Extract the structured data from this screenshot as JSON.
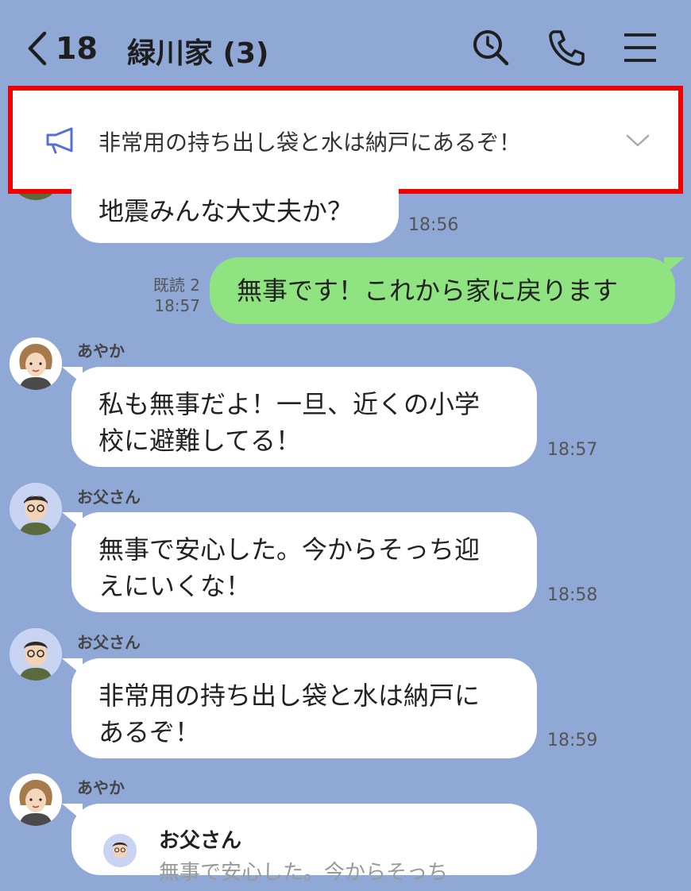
{
  "header": {
    "back_count": "18",
    "title": "緑川家 (3)",
    "icons": [
      "search-icon",
      "phone-icon",
      "menu-icon"
    ]
  },
  "announcement": {
    "icon": "megaphone-icon",
    "text": "非常用の持ち出し袋と水は納戸にあるぞ！"
  },
  "messages": [
    {
      "sender": "",
      "text": "地震みんな大丈夫か？",
      "time": "18:56"
    },
    {
      "sender": "me",
      "text": "無事です！これから家に戻ります",
      "read": "既読 2",
      "time": "18:57"
    },
    {
      "sender": "あやか",
      "text_line1": "私も無事だよ！一旦、近くの小学",
      "text_line2": "校に避難してる！",
      "time": "18:57"
    },
    {
      "sender": "お父さん",
      "text_line1": "無事で安心した。今からそっち迎",
      "text_line2": "えにいくな！",
      "time": "18:58"
    },
    {
      "sender": "お父さん",
      "text_line1": "非常用の持ち出し袋と水は納戸に",
      "text_line2": "あるぞ！",
      "time": "18:59"
    },
    {
      "sender": "あやか",
      "quote_name": "お父さん",
      "quote_text": "無事で安心した。今からそっち"
    }
  ],
  "colors": {
    "background": "#8fa8d6",
    "my_bubble": "#8fe381",
    "highlight_border": "#ee0000",
    "announce_icon": "#5470d8"
  }
}
